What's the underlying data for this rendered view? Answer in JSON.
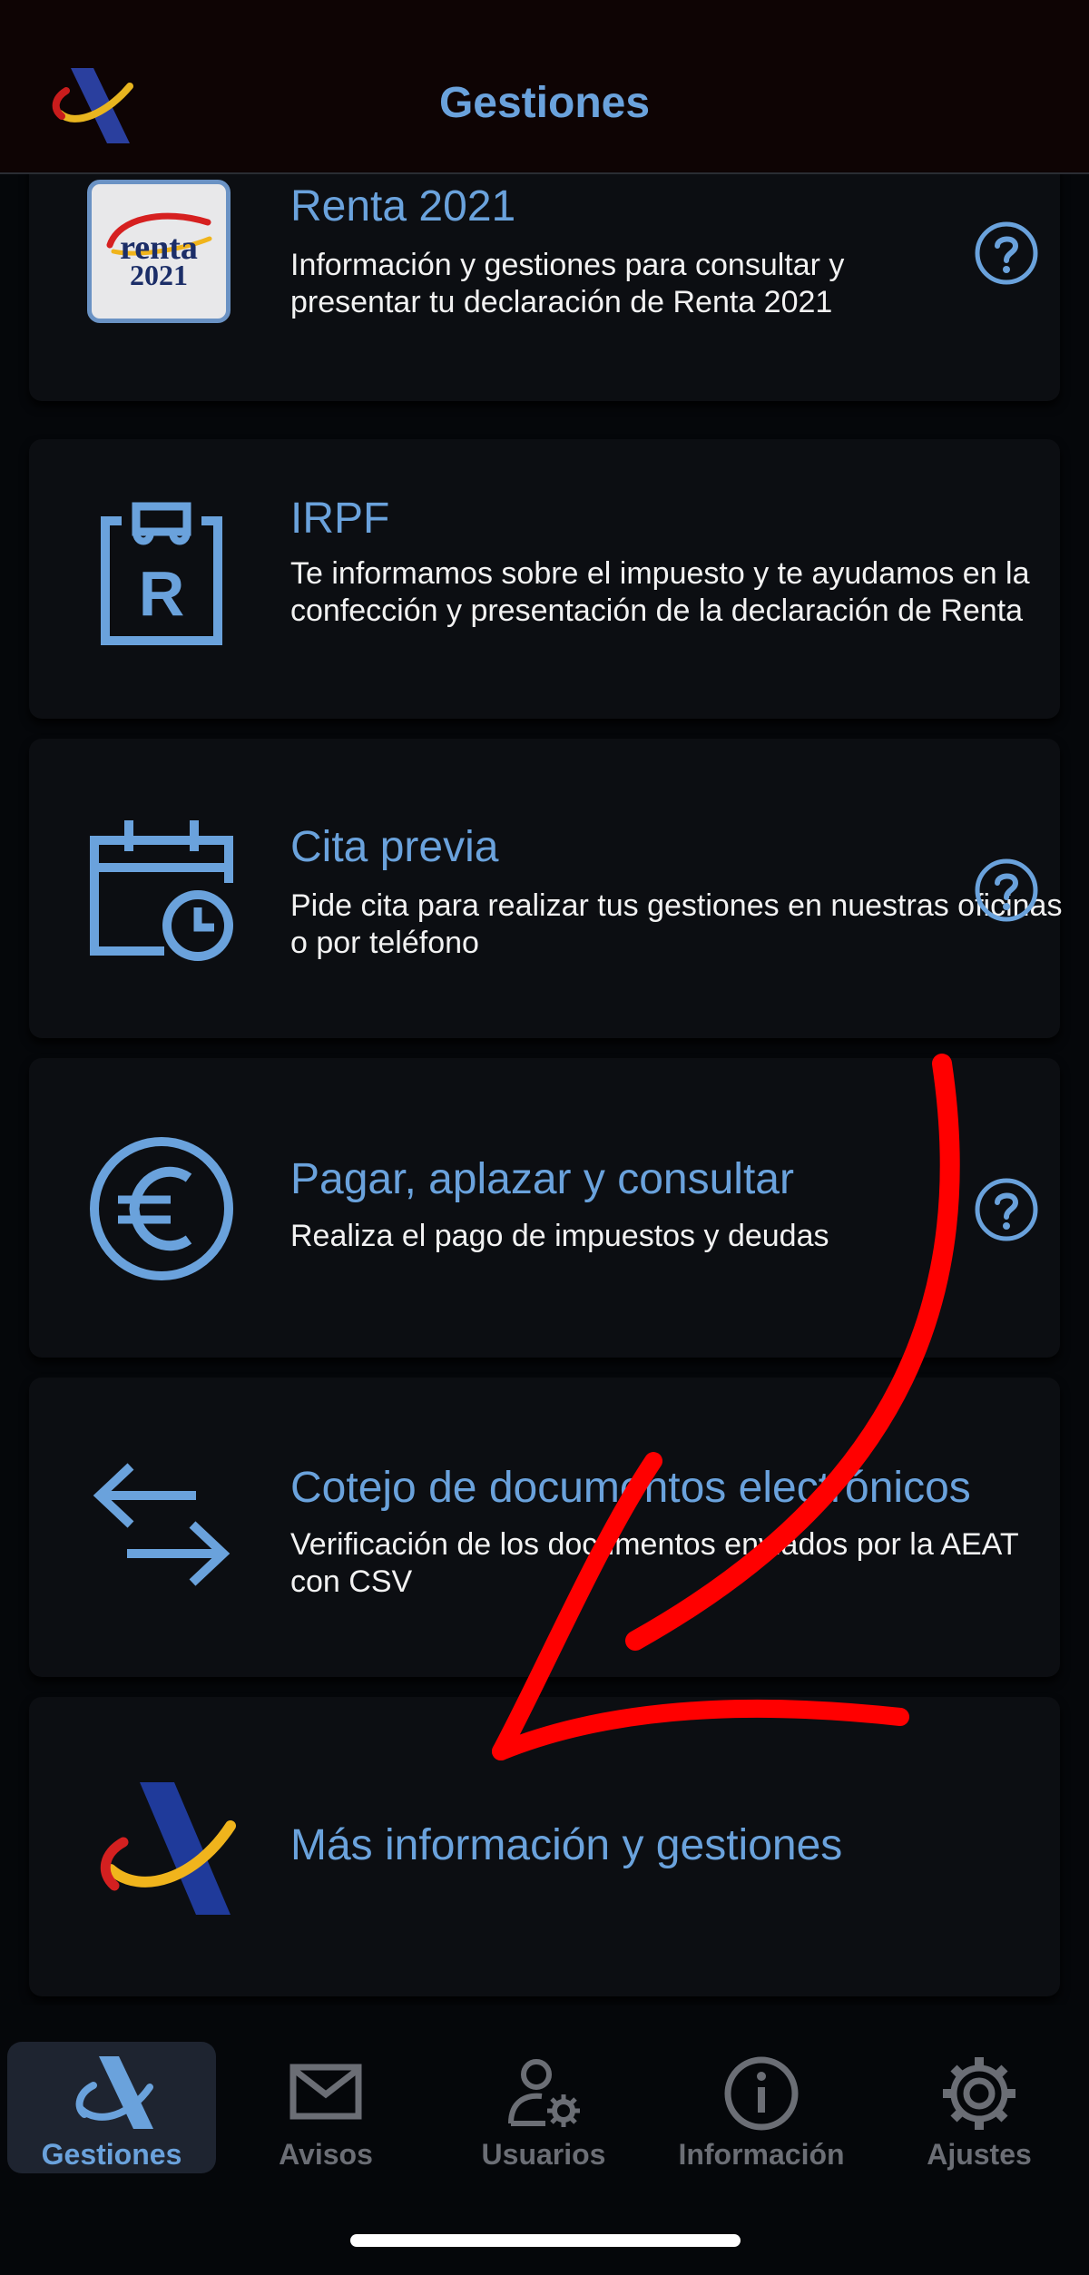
{
  "header": {
    "title": "Gestiones",
    "logo_icon": "agencia-tributaria-logo"
  },
  "cards": [
    {
      "title": "Renta 2021",
      "description": "Información y gestiones para consultar y presentar tu declaración de Renta 2021",
      "icon": "renta-2021-badge",
      "badge_word": "renta",
      "badge_year": "2021",
      "has_help": true
    },
    {
      "title": "IRPF",
      "description": "Te informamos sobre el impuesto y te ayudamos en la confección y presentación de la declaración de Renta",
      "icon": "irpf-document-icon",
      "has_help": false
    },
    {
      "title": "Cita previa",
      "description": "Pide cita para realizar tus gestiones en nuestras oficinas o por teléfono",
      "icon": "calendar-clock-icon",
      "has_help": true
    },
    {
      "title": "Pagar, aplazar y consultar",
      "description": "Realiza el pago de impuestos y deudas",
      "icon": "euro-icon",
      "has_help": true
    },
    {
      "title": "Cotejo de documentos electrónicos",
      "description": "Verificación de los documentos enviados por la AEAT con CSV",
      "icon": "exchange-arrows-icon",
      "has_help": false
    },
    {
      "title": "Más información y gestiones",
      "description": "",
      "icon": "agencia-tributaria-logo",
      "has_help": false
    }
  ],
  "tabs": [
    {
      "label": "Gestiones",
      "icon": "agencia-tributaria-logo",
      "active": true
    },
    {
      "label": "Avisos",
      "icon": "envelope-icon",
      "active": false
    },
    {
      "label": "Usuarios",
      "icon": "user-settings-icon",
      "active": false
    },
    {
      "label": "Información",
      "icon": "info-icon",
      "active": false
    },
    {
      "label": "Ajustes",
      "icon": "gear-icon",
      "active": false
    }
  ],
  "colors": {
    "accent": "#6aa2dc",
    "card": "#0c0e12",
    "background": "#05070a",
    "annotation_arrow": "#ff0000"
  }
}
